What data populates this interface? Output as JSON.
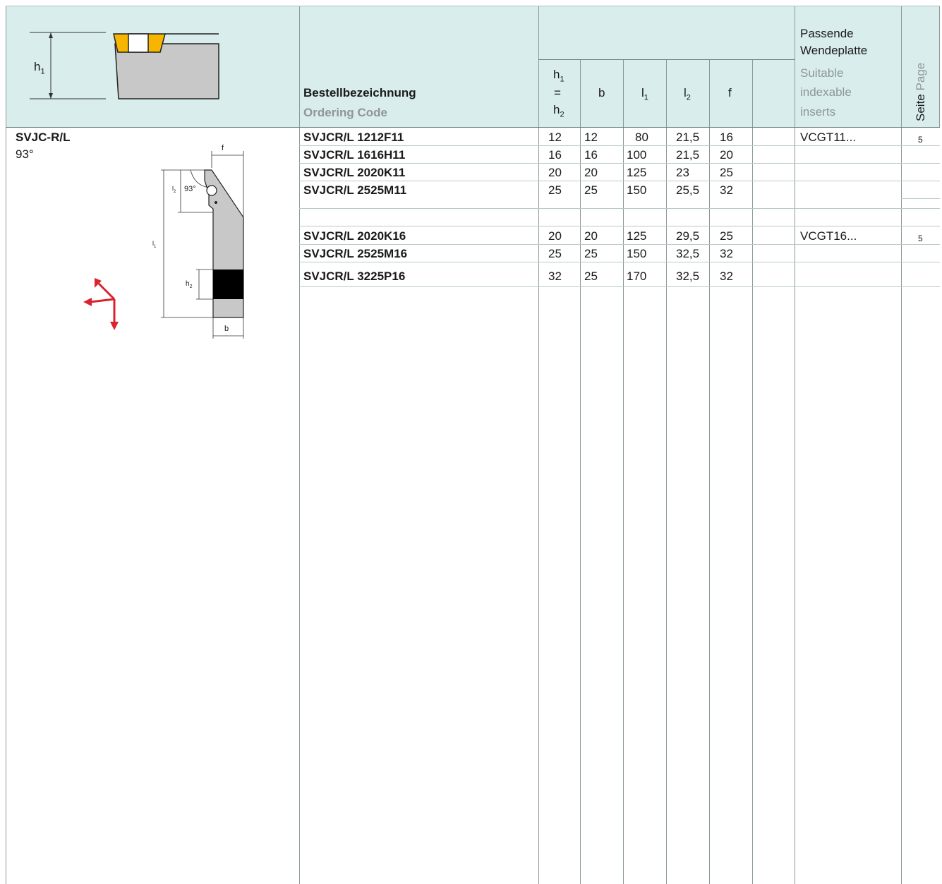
{
  "header": {
    "h1_label": "h",
    "h1_sub": "1",
    "ordering_de": "Bestellbezeichnung",
    "ordering_en": "Ordering Code",
    "col_h_top": "h",
    "col_h_top_sub": "1",
    "col_eq": "=",
    "col_h_bot": "h",
    "col_h_bot_sub": "2",
    "col_b": "b",
    "col_l1": "l",
    "col_l1_sub": "1",
    "col_l2": "l",
    "col_l2_sub": "2",
    "col_f": "f",
    "insert_de_1": "Passende",
    "insert_de_2": "Wendeplatte",
    "insert_en_1": "Suitable",
    "insert_en_2": "indexable",
    "insert_en_3": "inserts",
    "page_de": "Seite",
    "page_en": "Page"
  },
  "product": {
    "name": "SVJC-R/L",
    "angle": "93°",
    "drawing": {
      "f": "f",
      "l2": "l",
      "l2_sub": "2",
      "angle": "93°",
      "l1": "l",
      "l1_sub": "1",
      "h2": "h",
      "h2_sub": "2",
      "b": "b"
    }
  },
  "rows": [
    {
      "code": "SVJCR/L 1212F11",
      "h": "12",
      "b": "12",
      "l1": "80",
      "l2": "21,5",
      "f": "16",
      "insert": "VCGT11...",
      "page": "5"
    },
    {
      "code": "SVJCR/L 1616H11",
      "h": "16",
      "b": "16",
      "l1": "100",
      "l2": "21,5",
      "f": "20",
      "insert": "",
      "page": ""
    },
    {
      "code": "SVJCR/L 2020K11",
      "h": "20",
      "b": "20",
      "l1": "125",
      "l2": "23",
      "f": "25",
      "insert": "",
      "page": ""
    },
    {
      "code": "SVJCR/L 2525M11",
      "h": "25",
      "b": "25",
      "l1": "150",
      "l2": "25,5",
      "f": "32",
      "insert": "",
      "page": ""
    },
    {
      "code": "SVJCR/L 2020K16",
      "h": "20",
      "b": "20",
      "l1": "125",
      "l2": "29,5",
      "f": "25",
      "insert": "VCGT16...",
      "page": "5"
    },
    {
      "code": "SVJCR/L 2525M16",
      "h": "25",
      "b": "25",
      "l1": "150",
      "l2": "32,5",
      "f": "32",
      "insert": "",
      "page": ""
    },
    {
      "code": "SVJCR/L 3225P16",
      "h": "32",
      "b": "25",
      "l1": "170",
      "l2": "32,5",
      "f": "32",
      "insert": "",
      "page": ""
    }
  ],
  "colors": {
    "header_bg": "#d9eded",
    "insert_yellow": "#f7b500",
    "arrow_red": "#d9232e",
    "tool_grey": "#c8c8c8"
  }
}
